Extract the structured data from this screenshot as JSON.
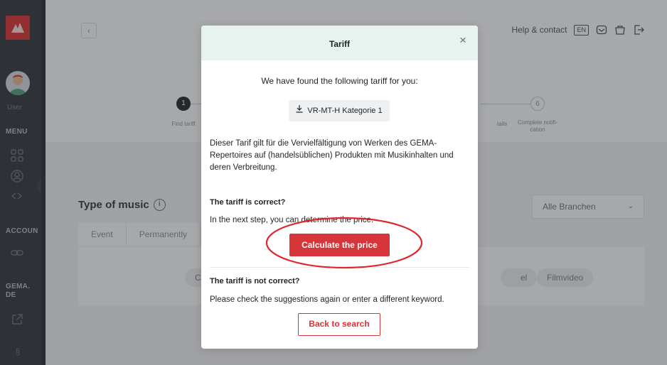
{
  "sidebar": {
    "user_label": "User",
    "menu_label": "MENU",
    "account_label": "ACCOUN",
    "gema_label": "GEMA.\nDE",
    "icons": [
      "grid-icon",
      "user-icon",
      "link-icon",
      "external-link-icon",
      "paragraph-icon"
    ]
  },
  "topbar": {
    "help": "Help & contact",
    "lang": "EN"
  },
  "steps": {
    "first_number": "1",
    "first_label": "Find tariff",
    "partial_label": "tails",
    "last_number": "6",
    "last_label": "Complete notifi-\ncation"
  },
  "page": {
    "type_of_music": "Type of music",
    "info_symbol": "i",
    "tabs": [
      "Event",
      "Permanently"
    ],
    "chips": [
      "CD, Vin",
      "el",
      "Filmvideo"
    ],
    "select_value": "Alle Branchen"
  },
  "modal": {
    "title": "Tariff",
    "found_text": "We have found the following tariff for you:",
    "tariff_name": "VR-MT-H Kategorie 1",
    "description": "Dieser Tarif gilt für die Vervielfältigung von Werken des GEMA-Repertoires auf (handelsüblichen) Produkten mit Musikinhalten und deren Verbreitung.",
    "correct_heading": "The tariff is correct?",
    "correct_text": "In the next step, you can determine the price.",
    "calc_button": "Calculate the price",
    "incorrect_heading": "The tariff is not correct?",
    "incorrect_text": "Please check the suggestions again or enter a different keyword.",
    "back_button": "Back to search"
  },
  "colors": {
    "brand_red": "#d6353a",
    "header_mint": "#e6f3ef",
    "sidebar_dark": "#2f3338",
    "annotation_red": "#e0262c"
  }
}
